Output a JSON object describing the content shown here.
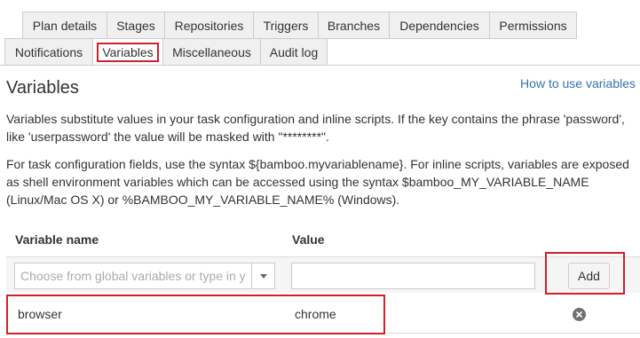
{
  "tabs_top": [
    {
      "label": "Plan details"
    },
    {
      "label": "Stages"
    },
    {
      "label": "Repositories"
    },
    {
      "label": "Triggers"
    },
    {
      "label": "Branches"
    },
    {
      "label": "Dependencies"
    },
    {
      "label": "Permissions"
    }
  ],
  "tabs_bottom": [
    {
      "label": "Notifications"
    },
    {
      "label": "Variables",
      "active": true
    },
    {
      "label": "Miscellaneous"
    },
    {
      "label": "Audit log"
    }
  ],
  "page": {
    "title": "Variables",
    "help_link": "How to use variables",
    "description_1": "Variables substitute values in your task configuration and inline scripts. If the key contains the phrase 'password', like 'userpassword' the value will be masked with \"********\".",
    "description_2": "For task configuration fields, use the syntax ${bamboo.myvariablename}. For inline scripts, variables are exposed as shell environment variables which can be accessed using the syntax $bamboo_MY_VARIABLE_NAME (Linux/Mac OS X) or %BAMBOO_MY_VARIABLE_NAME% (Windows)."
  },
  "table": {
    "col_name": "Variable name",
    "col_value": "Value",
    "new_row": {
      "name_placeholder": "Choose from global variables or type in y",
      "name_value": "",
      "value_value": "",
      "add_label": "Add"
    },
    "rows": [
      {
        "name": "browser",
        "value": "chrome"
      }
    ]
  },
  "colors": {
    "link": "#3572b0",
    "highlight": "#d0202a",
    "tab_bg": "#f0f0f0"
  }
}
